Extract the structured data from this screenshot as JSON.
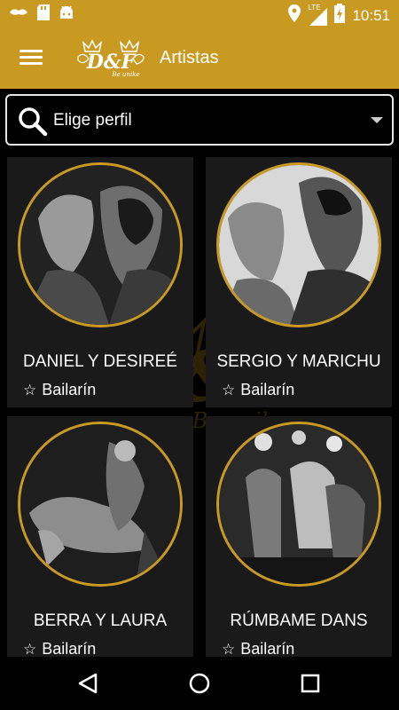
{
  "status_bar": {
    "time": "10:51",
    "network": "LTE",
    "left_icons": [
      "cat-logo-icon",
      "sd-card-icon",
      "android-icon"
    ],
    "right_icons": [
      "location-icon",
      "lte-signal-icon",
      "battery-charging-icon"
    ]
  },
  "app_bar": {
    "title": "Artistas",
    "logo_text": "D&F",
    "logo_subtext": "Be unike",
    "color": "#c99a22"
  },
  "search": {
    "placeholder": "Elige perfil"
  },
  "watermark": {
    "text": "D&F",
    "subtext": "Be unike"
  },
  "artists": [
    {
      "name": "DANIEL Y DESIREÉ",
      "role": "Bailarín"
    },
    {
      "name": "SERGIO Y MARICHU",
      "role": "Bailarín"
    },
    {
      "name": "BERRA Y LAURA",
      "role": "Bailarín"
    },
    {
      "name": "RÚMBAME DANS",
      "role": "Bailarín"
    }
  ],
  "colors": {
    "accent": "#c99a22",
    "card_bg": "#1a1a1a",
    "background": "#000000"
  }
}
